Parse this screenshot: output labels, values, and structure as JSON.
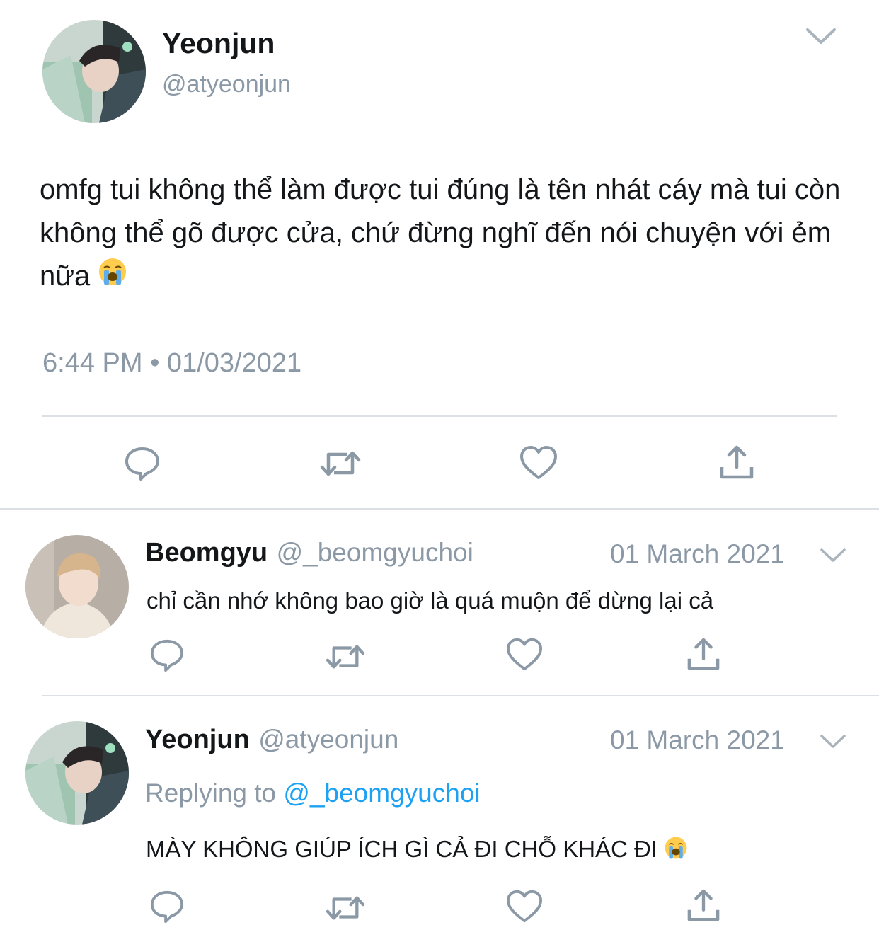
{
  "main_tweet": {
    "name": "Yeonjun",
    "handle": "@atyeonjun",
    "text": "omfg tui không thể làm được tui đúng là tên nhát cáy mà tui còn không thể gõ được cửa, chứ đừng nghĩ đến nói chuyện với ẻm nữa",
    "emoji": "loudly-crying-face",
    "timestamp": "6:44 PM • 01/03/2021"
  },
  "replies": [
    {
      "name": "Beomgyu",
      "handle": "@_beomgyuchoi",
      "date": "01 March 2021",
      "text": "chỉ cần nhớ không bao giờ là quá muộn để dừng lại cả"
    },
    {
      "name": "Yeonjun",
      "handle": "@atyeonjun",
      "date": "01 March 2021",
      "replying_label": "Replying to",
      "replying_to": "@_beomgyuchoi",
      "text": "MÀY KHÔNG GIÚP ÍCH GÌ CẢ ĐI CHỖ KHÁC ĐI",
      "emoji": "loudly-crying-face"
    }
  ],
  "icons": [
    "reply-icon",
    "retweet-icon",
    "like-icon",
    "share-icon",
    "chevron-down-icon"
  ],
  "colors": {
    "text": "#14171a",
    "muted": "#8b98a5",
    "link": "#1da1f2",
    "divider": "#dcdfe3"
  }
}
